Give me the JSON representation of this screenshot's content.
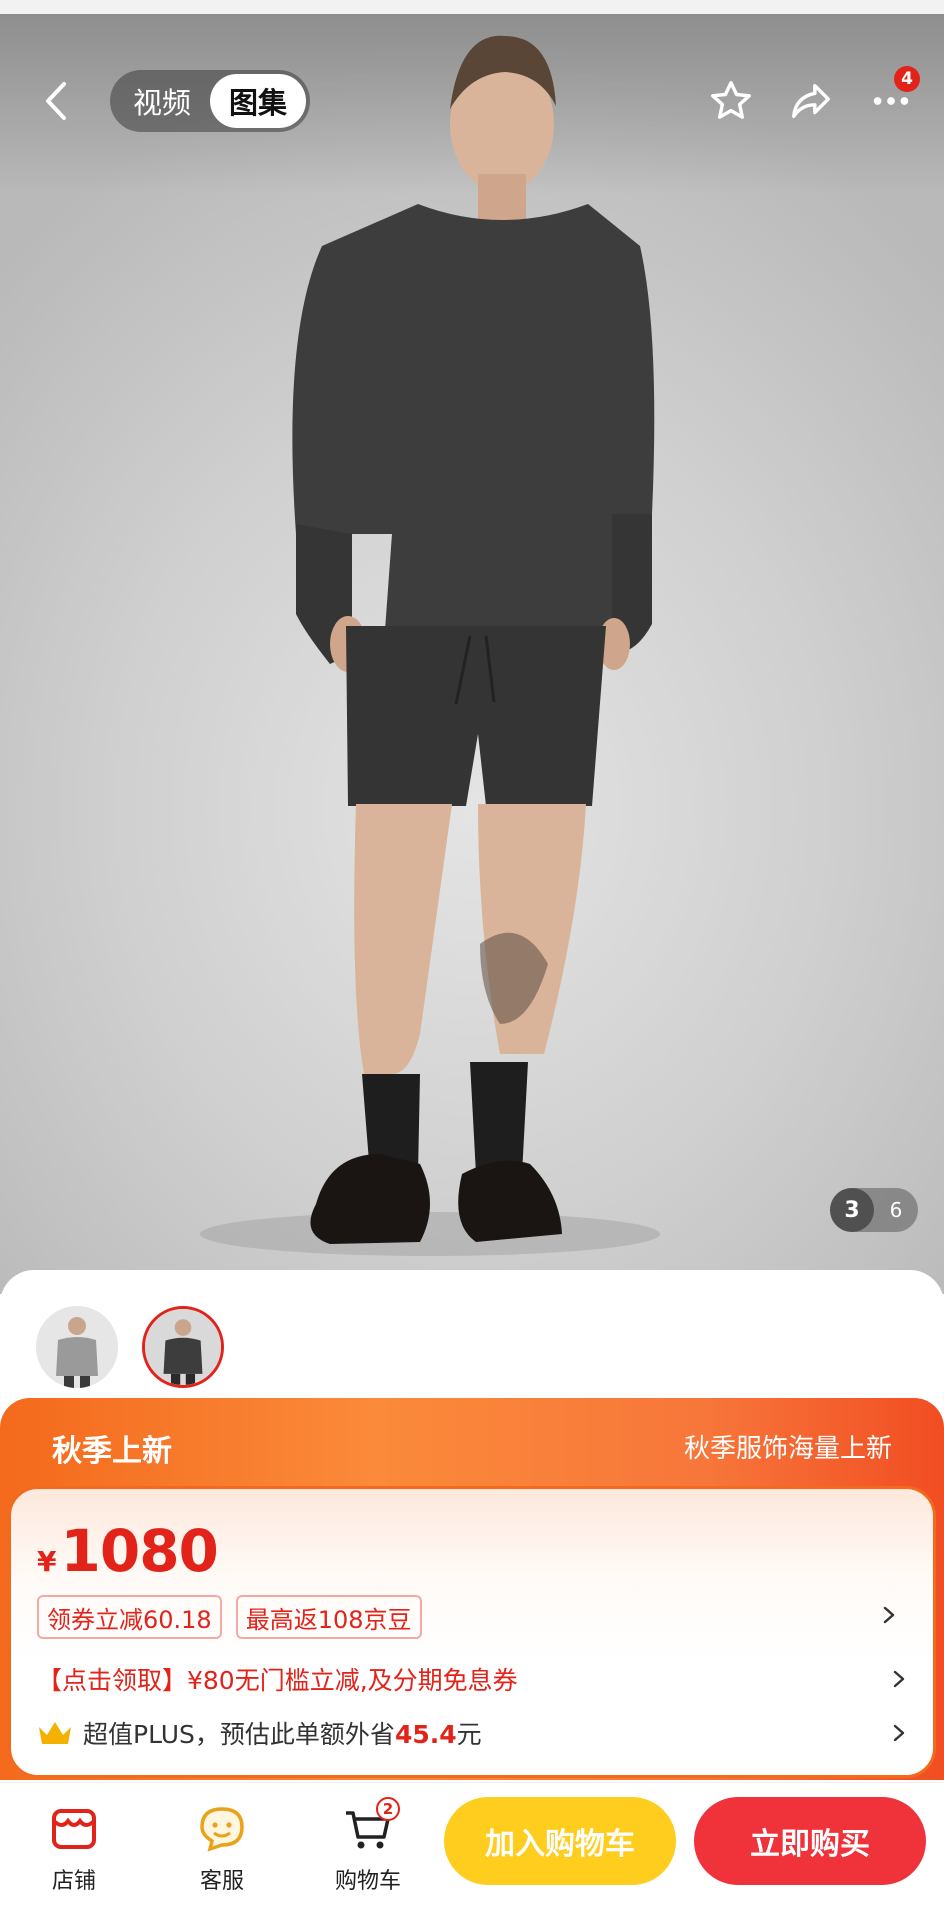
{
  "header": {
    "segments": [
      {
        "label": "视频",
        "active": false
      },
      {
        "label": "图集",
        "active": true
      }
    ],
    "more_badge": "4"
  },
  "gallery": {
    "current": "3",
    "total": "6",
    "thumbnails": [
      {
        "variant": "light-grey sweatshirt",
        "active": false
      },
      {
        "variant": "charcoal sweatshirt",
        "active": true
      }
    ]
  },
  "promo": {
    "left_title": "秋季上新",
    "right_text": "秋季服饰海量上新"
  },
  "price": {
    "symbol": "¥",
    "amount": "1080"
  },
  "tags": [
    {
      "label": "领券立减60.18"
    },
    {
      "label": "最高返108京豆"
    }
  ],
  "coupon": {
    "text": "【点击领取】¥80无门槛立减,及分期免息券"
  },
  "plus": {
    "prefix": "超值PLUS，预估此单额外省",
    "amount": "45.4",
    "suffix": "元"
  },
  "action_bar": {
    "store_label": "店铺",
    "service_label": "客服",
    "cart_label": "购物车",
    "cart_badge": "2",
    "add_to_cart_label": "加入购物车",
    "buy_now_label": "立即购买"
  },
  "colors": {
    "brand_red": "#e2231a",
    "promo_orange": "#f46a1c",
    "add_to_cart_yellow": "#ffcd1e",
    "buy_now_red": "#f0323a"
  }
}
